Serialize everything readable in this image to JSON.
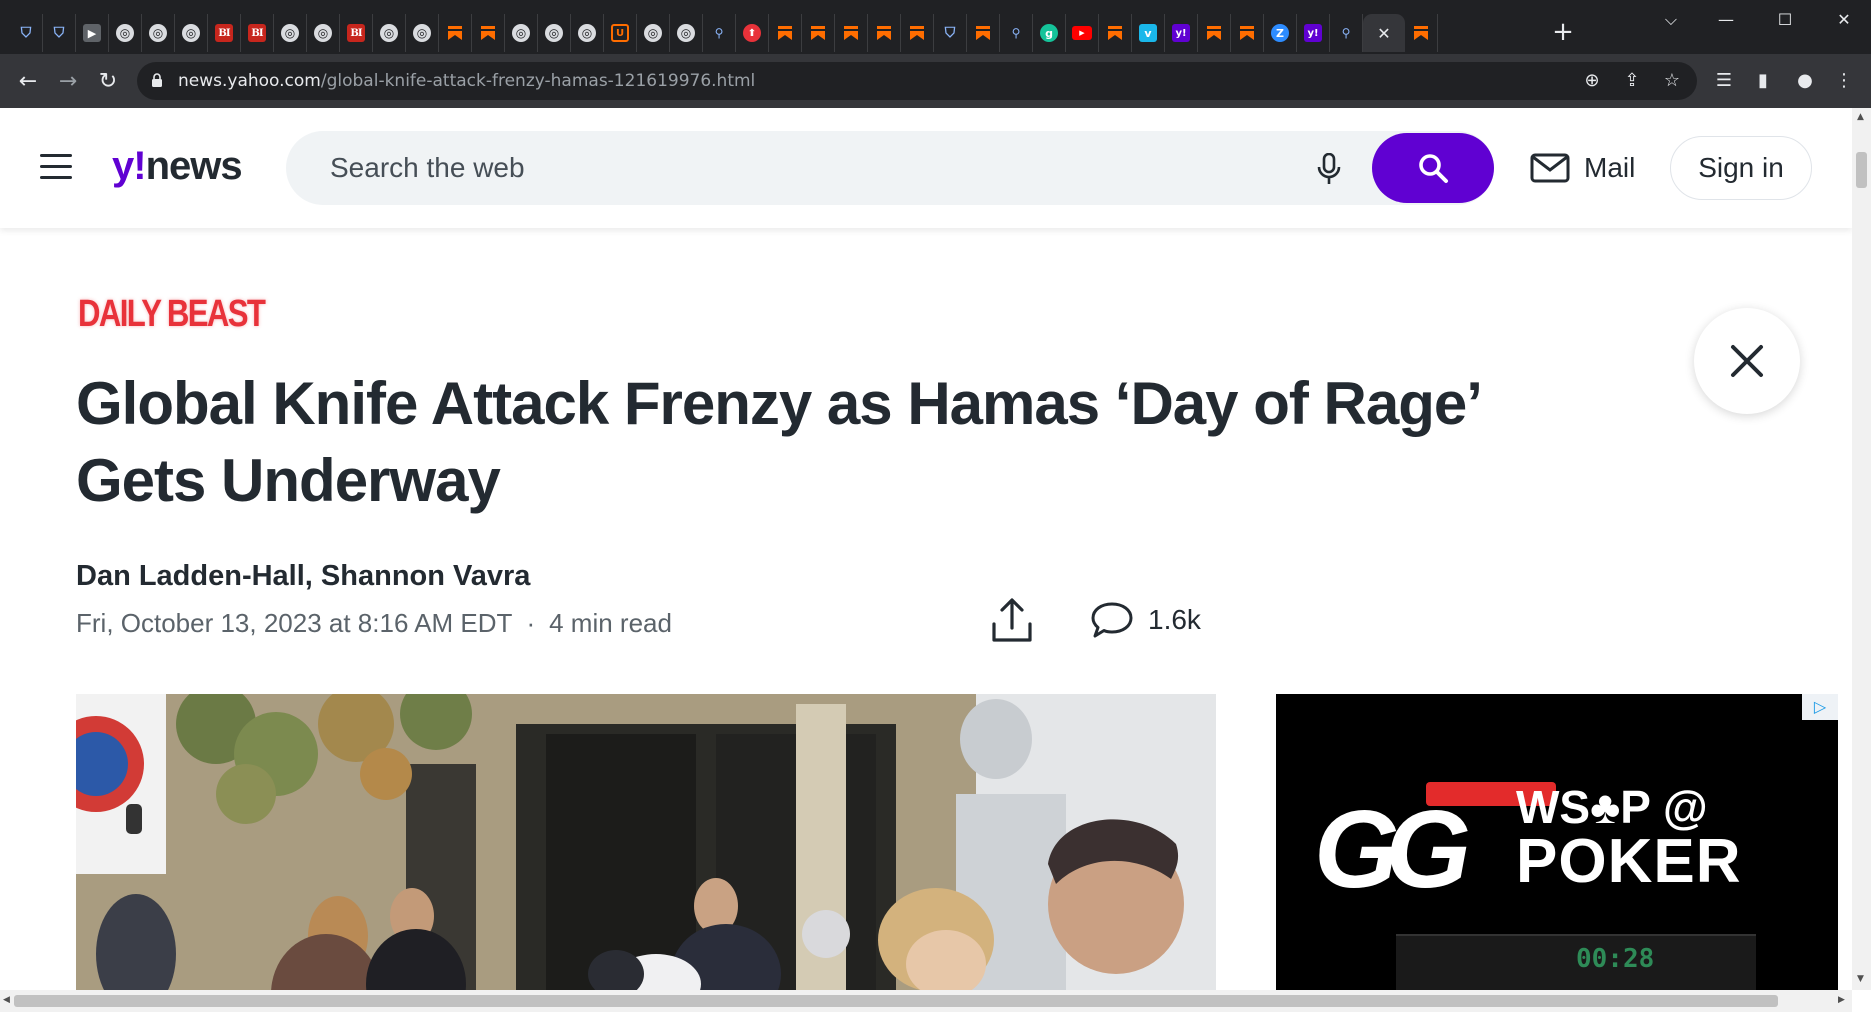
{
  "browser": {
    "tabs": [
      {
        "icon": "shield-icon",
        "label": "⛉",
        "kind": "shield"
      },
      {
        "icon": "shield-icon",
        "label": "⛉",
        "kind": "shield"
      },
      {
        "icon": "tag-icon",
        "label": "▶",
        "kind": "dark"
      },
      {
        "icon": "globe-icon",
        "label": "◎",
        "kind": "globe"
      },
      {
        "icon": "globe-icon",
        "label": "◎",
        "kind": "globe"
      },
      {
        "icon": "globe-icon",
        "label": "◎",
        "kind": "globe"
      },
      {
        "icon": "business-insider-icon",
        "label": "BI",
        "kind": "bi"
      },
      {
        "icon": "business-insider-icon",
        "label": "BI",
        "kind": "bi"
      },
      {
        "icon": "globe-icon",
        "label": "◎",
        "kind": "globe"
      },
      {
        "icon": "globe-icon",
        "label": "◎",
        "kind": "globe"
      },
      {
        "icon": "business-insider-icon",
        "label": "BI",
        "kind": "bi"
      },
      {
        "icon": "globe-icon",
        "label": "◎",
        "kind": "globe"
      },
      {
        "icon": "globe-icon",
        "label": "◎",
        "kind": "globe"
      },
      {
        "icon": "bookmark-icon",
        "label": "",
        "kind": "bookmark"
      },
      {
        "icon": "bookmark-icon",
        "label": "",
        "kind": "bookmark"
      },
      {
        "icon": "globe-icon",
        "label": "◎",
        "kind": "globe"
      },
      {
        "icon": "globe-icon",
        "label": "◎",
        "kind": "globe"
      },
      {
        "icon": "globe-icon",
        "label": "◎",
        "kind": "globe"
      },
      {
        "icon": "u-shield-icon",
        "label": "U",
        "kind": "u"
      },
      {
        "icon": "globe-icon",
        "label": "◎",
        "kind": "globe"
      },
      {
        "icon": "globe-icon",
        "label": "◎",
        "kind": "globe"
      },
      {
        "icon": "search-icon",
        "label": "⚲",
        "kind": "search"
      },
      {
        "icon": "red-pin-icon",
        "label": "⬆",
        "kind": "red"
      },
      {
        "icon": "bookmark-icon",
        "label": "",
        "kind": "bookmark"
      },
      {
        "icon": "bookmark-icon",
        "label": "",
        "kind": "bookmark"
      },
      {
        "icon": "bookmark-icon",
        "label": "",
        "kind": "bookmark"
      },
      {
        "icon": "bookmark-icon",
        "label": "",
        "kind": "bookmark"
      },
      {
        "icon": "bookmark-icon",
        "label": "",
        "kind": "bookmark"
      },
      {
        "icon": "shield-icon",
        "label": "⛉",
        "kind": "shield"
      },
      {
        "icon": "bookmark-icon",
        "label": "",
        "kind": "bookmark"
      },
      {
        "icon": "search-icon",
        "label": "⚲",
        "kind": "search"
      },
      {
        "icon": "grammarly-icon",
        "label": "g",
        "kind": "grammarly"
      },
      {
        "icon": "youtube-icon",
        "label": "▶",
        "kind": "yt"
      },
      {
        "icon": "bookmark-icon",
        "label": "",
        "kind": "bookmark"
      },
      {
        "icon": "vimeo-icon",
        "label": "v",
        "kind": "v"
      },
      {
        "icon": "yahoo-icon",
        "label": "y!",
        "kind": "y"
      },
      {
        "icon": "bookmark-icon",
        "label": "",
        "kind": "bookmark"
      },
      {
        "icon": "bookmark-icon",
        "label": "",
        "kind": "bookmark"
      },
      {
        "icon": "zoom-icon",
        "label": "Z",
        "kind": "z"
      },
      {
        "icon": "yahoo-icon",
        "label": "y!",
        "kind": "y"
      },
      {
        "icon": "search-icon",
        "label": "⚲",
        "kind": "search"
      },
      {
        "icon": "close-icon",
        "label": "✕",
        "kind": "active"
      },
      {
        "icon": "bookmark-icon",
        "label": "",
        "kind": "bookmark"
      }
    ],
    "new_tab_glyph": "+",
    "window_controls": {
      "tab_search": "⌵",
      "minimize": "—",
      "maximize": "☐",
      "close": "✕"
    },
    "nav": {
      "back": "←",
      "forward": "→",
      "reload": "↻"
    },
    "url": {
      "host": "news.yahoo.com",
      "path": "/global-knife-attack-frenzy-hamas-121619976.html"
    },
    "omnibox_icons": {
      "zoom": "⊕",
      "share": "⇪",
      "star": "☆"
    },
    "toolbar_icons": {
      "reading_list": "☰",
      "side_panel": "▮",
      "profile": "●",
      "menu": "⋮"
    }
  },
  "header": {
    "logo_y": "y!",
    "logo_word": "news",
    "search_placeholder": "Search the web",
    "mail_label": "Mail",
    "signin_label": "Sign in"
  },
  "article": {
    "publisher": "DAILY BEAST",
    "headline": "Global Knife Attack Frenzy as Hamas ‘Day of Rage’ Gets Underway",
    "authors": "Dan Ladden-Hall, Shannon Vavra",
    "date": "Fri, October 13, 2023 at 8:16 AM EDT",
    "separator": "·",
    "read_time": "4 min read",
    "comment_count": "1.6k"
  },
  "ad": {
    "badge": "▷",
    "brand_mark": "GG",
    "line1": "WS♣P @",
    "line2": "POKER",
    "timer": "00:28"
  },
  "colors": {
    "accent": "#6001d2",
    "publisher_red": "#e8323a",
    "text": "#232a31",
    "chrome_bg": "#202124",
    "bookmark_orange": "#ff6d00"
  }
}
